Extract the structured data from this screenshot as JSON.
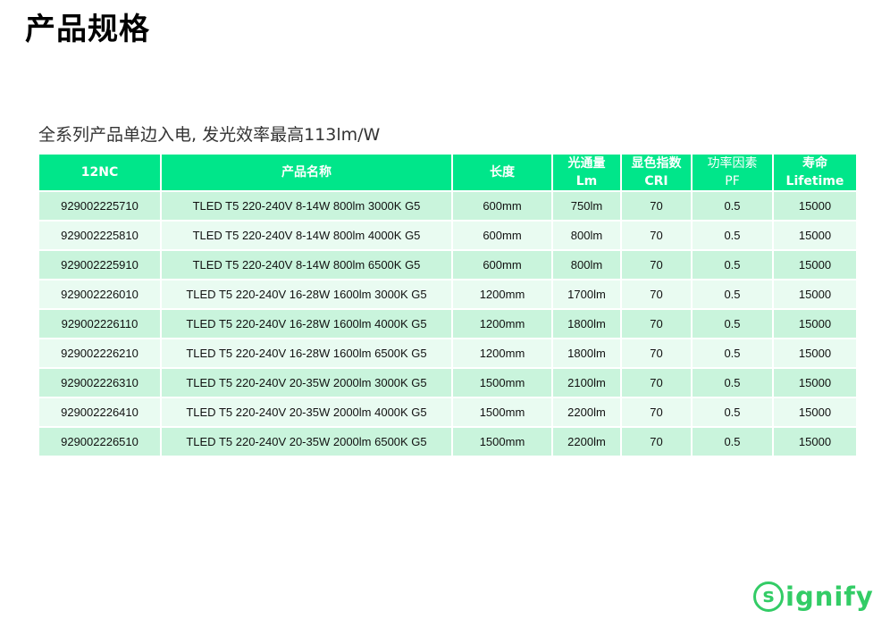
{
  "page": {
    "title": "产品规格",
    "subtitle": "全系列产品单边入电, 发光效率最高113lm/W"
  },
  "table": {
    "headers": [
      {
        "line1": "12NC",
        "line2": ""
      },
      {
        "line1": "产品名称",
        "line2": ""
      },
      {
        "line1": "长度",
        "line2": ""
      },
      {
        "line1": "光通量",
        "line2": "Lm"
      },
      {
        "line1": "显色指数",
        "line2": "CRI"
      },
      {
        "line1": "功率因素",
        "line2": "PF"
      },
      {
        "line1": "寿命",
        "line2": "Lifetime"
      }
    ],
    "rows": [
      [
        "929002225710",
        "TLED T5 220-240V 8-14W 800lm 3000K G5",
        "600mm",
        "750lm",
        "70",
        "0.5",
        "15000"
      ],
      [
        "929002225810",
        "TLED T5 220-240V 8-14W 800lm 4000K G5",
        "600mm",
        "800lm",
        "70",
        "0.5",
        "15000"
      ],
      [
        "929002225910",
        "TLED T5 220-240V 8-14W 800lm 6500K G5",
        "600mm",
        "800lm",
        "70",
        "0.5",
        "15000"
      ],
      [
        "929002226010",
        "TLED T5 220-240V 16-28W 1600lm 3000K G5",
        "1200mm",
        "1700lm",
        "70",
        "0.5",
        "15000"
      ],
      [
        "929002226110",
        "TLED T5 220-240V 16-28W 1600lm 4000K G5",
        "1200mm",
        "1800lm",
        "70",
        "0.5",
        "15000"
      ],
      [
        "929002226210",
        "TLED T5 220-240V 16-28W 1600lm 6500K G5",
        "1200mm",
        "1800lm",
        "70",
        "0.5",
        "15000"
      ],
      [
        "929002226310",
        "TLED T5 220-240V 20-35W 2000lm 3000K G5",
        "1500mm",
        "2100lm",
        "70",
        "0.5",
        "15000"
      ],
      [
        "929002226410",
        "TLED T5 220-240V 20-35W 2000lm 4000K G5",
        "1500mm",
        "2200lm",
        "70",
        "0.5",
        "15000"
      ],
      [
        "929002226510",
        "TLED T5 220-240V 20-35W 2000lm 6500K G5",
        "1500mm",
        "2200lm",
        "70",
        "0.5",
        "15000"
      ]
    ]
  },
  "logo": {
    "text": "ignify",
    "icon": "signify-s-circle-icon",
    "color": "#33cc66"
  },
  "colors": {
    "header_bg": "#00e68a",
    "row_odd": "#c9f4dc",
    "row_even": "#e9fbf1"
  }
}
